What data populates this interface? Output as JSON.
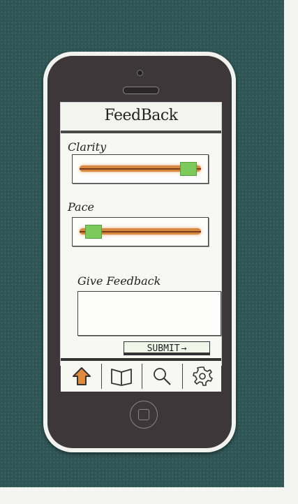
{
  "header": {
    "title": "FeedBack"
  },
  "sliders": [
    {
      "label": "Clarity",
      "value": 0.95
    },
    {
      "label": "Pace",
      "value": 0.05
    }
  ],
  "feedback": {
    "label": "Give Feedback",
    "value": ""
  },
  "submit": {
    "label": "SUBMIT",
    "arrow": "→"
  },
  "tabs": [
    {
      "icon": "home-icon",
      "active": true
    },
    {
      "icon": "book-icon",
      "active": false
    },
    {
      "icon": "search-icon",
      "active": false
    },
    {
      "icon": "gear-icon",
      "active": false
    }
  ],
  "colors": {
    "accent": "#d9893f",
    "thumb": "#7ccb5a",
    "active_tab": "#e08a3c"
  }
}
